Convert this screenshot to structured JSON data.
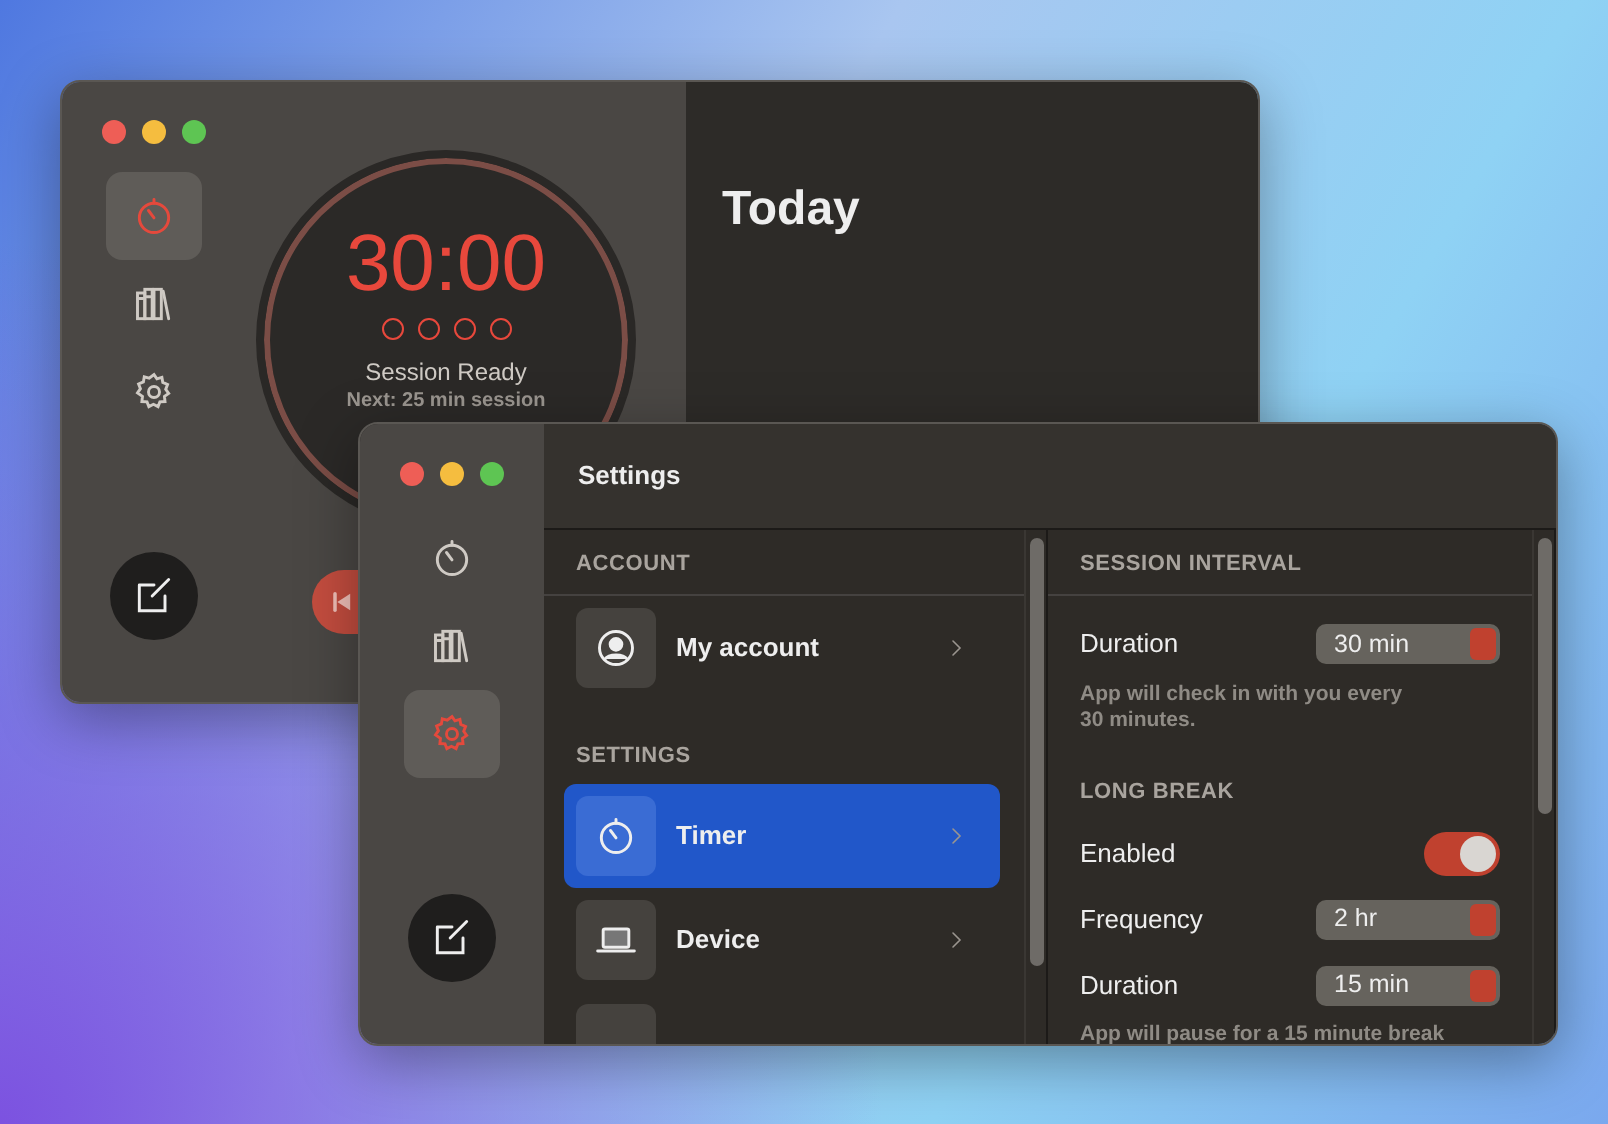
{
  "timer_window": {
    "sidebar": [
      {
        "selected": true
      },
      {
        "selected": false
      },
      {
        "selected": false
      }
    ],
    "time": "30:00",
    "sessions": [
      {
        "done": false
      },
      {
        "done": false
      },
      {
        "done": false
      },
      {
        "done": false
      }
    ],
    "status": "Session Ready",
    "next": "Next: 25 min session",
    "today_title": "Today"
  },
  "settings_window": {
    "title": "Settings",
    "sidebar": [
      {
        "selected": false
      },
      {
        "selected": false
      },
      {
        "selected": true
      }
    ],
    "sections": [
      {
        "heading": "ACCOUNT",
        "items": [
          {
            "kind": "account",
            "label": "My account",
            "selected": false
          }
        ]
      },
      {
        "heading": "SETTINGS",
        "items": [
          {
            "kind": "timer",
            "label": "Timer",
            "selected": true
          },
          {
            "kind": "device",
            "label": "Device",
            "selected": false
          },
          {
            "kind": "blank",
            "selected": false
          }
        ]
      }
    ],
    "groups": [
      {
        "heading": "SESSION INTERVAL",
        "rows": [
          {
            "kind": "select",
            "label": "Duration",
            "value": "30 min"
          }
        ],
        "note": "App will check in with you every 30 minutes."
      },
      {
        "heading": "LONG BREAK",
        "rows": [
          {
            "kind": "toggle",
            "label": "Enabled",
            "on": true
          },
          {
            "kind": "select",
            "label": "Frequency",
            "value": "2 hr"
          },
          {
            "kind": "select",
            "label": "Duration",
            "value": "15 min"
          }
        ],
        "note": "App will pause for a 15 minute break"
      }
    ]
  }
}
